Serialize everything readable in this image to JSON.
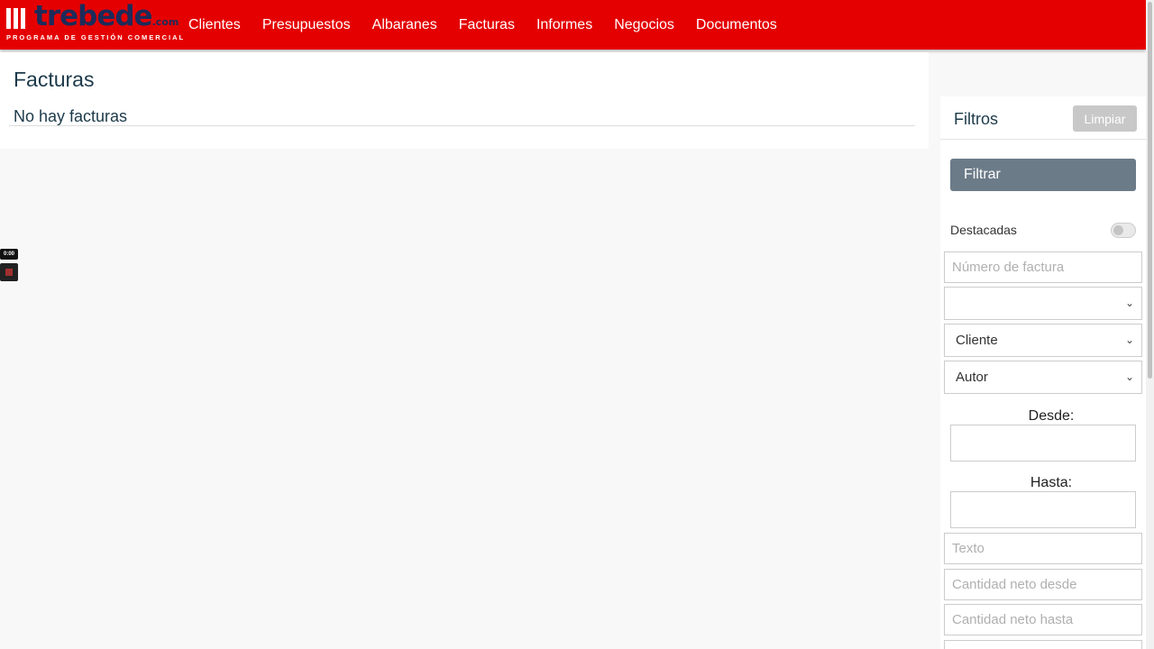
{
  "logo": {
    "word": "trebede",
    "suffix": ".com",
    "tagline": "PROGRAMA DE GESTIÓN COMERCIAL"
  },
  "nav": [
    "Clientes",
    "Presupuestos",
    "Albaranes",
    "Facturas",
    "Informes",
    "Negocios",
    "Documentos"
  ],
  "main": {
    "title": "Facturas",
    "empty_message": "No hay facturas"
  },
  "recorder": {
    "timer": "0:00"
  },
  "filters": {
    "title": "Filtros",
    "clear_label": "Limpiar",
    "filter_label": "Filtrar",
    "featured_label": "Destacadas",
    "invoice_number_placeholder": "Número de factura",
    "status_select": "",
    "client_select": "Cliente",
    "author_select": "Autor",
    "from_label": "Desde:",
    "to_label": "Hasta:",
    "text_placeholder": "Texto",
    "net_from_placeholder": "Cantidad neto desde",
    "net_to_placeholder": "Cantidad neto hasta"
  },
  "colors": {
    "brand": "#e40000",
    "filter_button": "#6c7b88",
    "clear_button": "#c8c8c8"
  }
}
